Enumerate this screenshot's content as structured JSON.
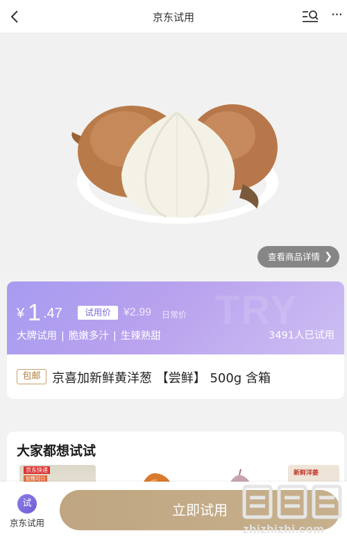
{
  "nav": {
    "title": "京东试用",
    "more": "···"
  },
  "hero": {
    "detail_button": "查看商品详情",
    "detail_chevron": "❯"
  },
  "price": {
    "currency": "¥",
    "integer": "1",
    "decimal": ".47",
    "tag": "试用价",
    "original": "¥2.99",
    "original_label": "日常价",
    "features": [
      "大牌试用",
      "脆嫩多汁",
      "生辣熟甜"
    ],
    "separator": "|",
    "trial_count": "3491人已试用",
    "colors": {
      "gradient_start": "#a79bf0",
      "gradient_end": "#cdbff3"
    }
  },
  "product": {
    "badge": "包邮",
    "title": "京喜加新鲜黄洋葱 【尝鲜】 500g 含箱"
  },
  "recommend": {
    "title": "大家都想试试",
    "thumb_labels": [
      "京东快递",
      "软糯可口",
      "新鲜洋姜"
    ]
  },
  "bottom_bar": {
    "tab_icon": "试",
    "tab_label": "京东试用",
    "cta": "立即试用",
    "cta_color": "#c2a985"
  },
  "watermark": {
    "site": "zhizhizhi.com"
  }
}
